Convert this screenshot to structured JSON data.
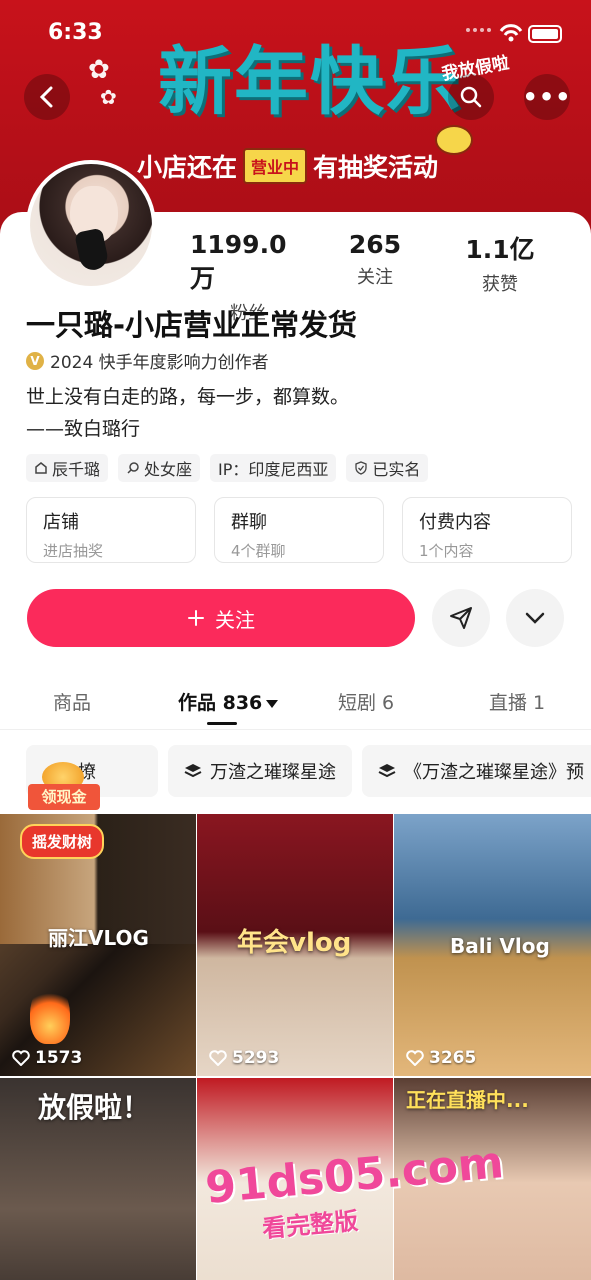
{
  "status_bar": {
    "time": "6:33"
  },
  "banner": {
    "title": "新年快乐",
    "subtitle_left": "小店还在",
    "subtitle_tag": "营业中",
    "subtitle_right": "有抽奖活动",
    "deco_text": "我放假啦",
    "colors": {
      "background": "#c8121b",
      "title": "#21b6c4"
    }
  },
  "header": {
    "back_icon": "chevron-left-icon",
    "search_icon": "search-icon",
    "more_icon": "more-dots-icon"
  },
  "profile": {
    "stats": [
      {
        "value": "1199.0万",
        "label": "粉丝"
      },
      {
        "value": "265",
        "label": "关注"
      },
      {
        "value": "1.1亿",
        "label": "获赞"
      }
    ],
    "name": "一只璐-小店营业正常发货",
    "badge": "2024 快手年度影响力创作者",
    "bio_line1": "世上没有白走的路，每一步，都算数。",
    "bio_line2": "——致白璐行",
    "tags": [
      "辰千璐",
      "处女座",
      "IP：印度尼西亚",
      "已实名"
    ]
  },
  "entries": [
    {
      "title": "店铺",
      "sub": "进店抽奖"
    },
    {
      "title": "群聊",
      "sub": "4个群聊"
    },
    {
      "title": "付费内容",
      "sub": "1个内容"
    }
  ],
  "actions": {
    "follow_label": "关注",
    "accent": "#fb2a5b"
  },
  "tabs": [
    {
      "label": "商品"
    },
    {
      "label": "作品 836"
    },
    {
      "label": "短剧 6"
    },
    {
      "label": "直播 1"
    }
  ],
  "collections": [
    "撩",
    "万渣之璀璨星途",
    "《万渣之璀璨星途》预"
  ],
  "redpacket_label": "领现金",
  "videos": [
    {
      "likes": "1573",
      "overlay": "丽江VLOG",
      "pill": "摇发财树"
    },
    {
      "likes": "5293",
      "overlay": "年会vlog"
    },
    {
      "likes": "3265",
      "overlay": "Bali Vlog"
    },
    {
      "overlay": "放假啦！"
    },
    {
      "overlay": ""
    },
    {
      "overlay": "正在直播中..."
    }
  ],
  "watermark": {
    "main": "91ds05.com",
    "sub": "看完整版"
  }
}
